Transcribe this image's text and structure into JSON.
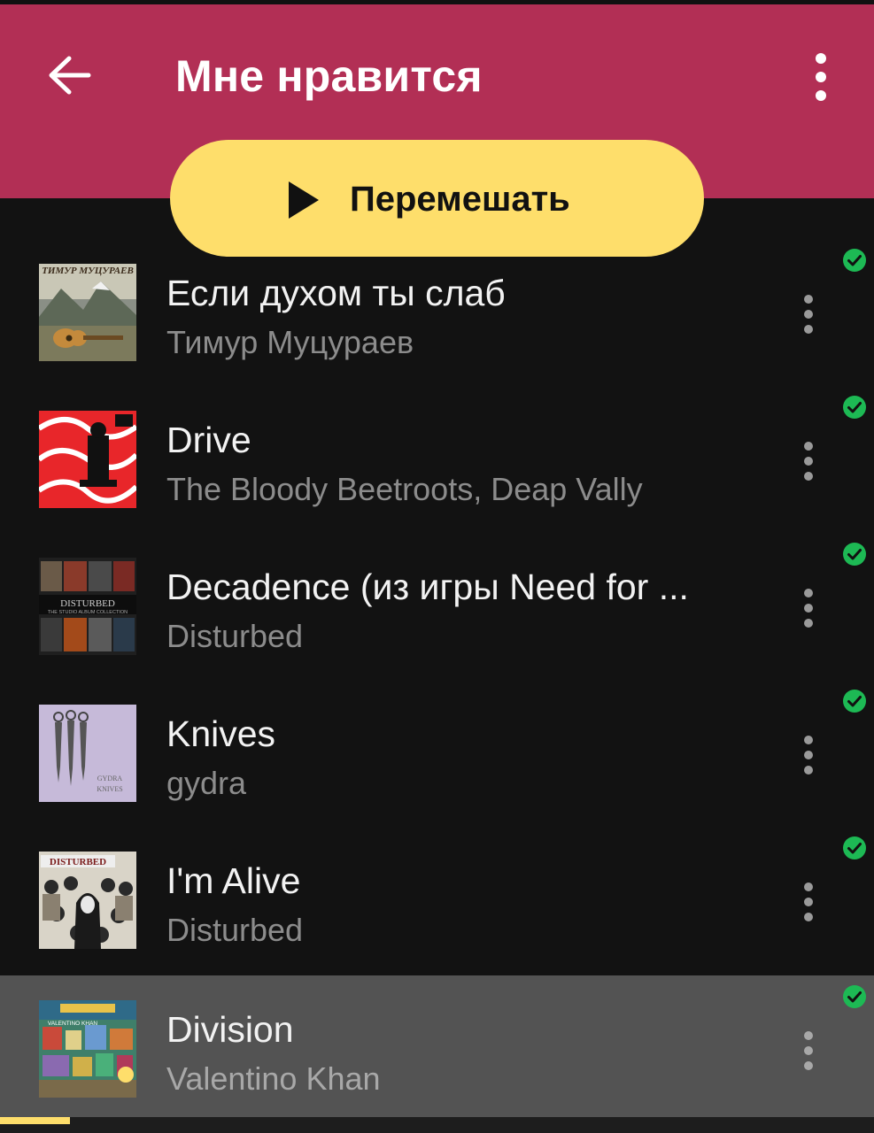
{
  "header": {
    "title": "Мне нравится",
    "back_icon": "arrow-left-icon",
    "menu_icon": "more-vertical-icon",
    "color": "#b22f55"
  },
  "shuffle": {
    "label": "Перемешать",
    "icon": "play-icon",
    "color": "#fede6b"
  },
  "tracks": [
    {
      "title": "Если духом ты слаб",
      "artist": "Тимур Муцураев",
      "cover_text": "ТИМУР МУЦУРАЕВ",
      "downloaded": true
    },
    {
      "title": "Drive",
      "artist": "The Bloody Beetroots, Deap Vally",
      "cover_text": "",
      "downloaded": true
    },
    {
      "title": "Decadence (из игры Need for ...",
      "artist": "Disturbed",
      "cover_text": "DISTURBED",
      "cover_subtext": "THE STUDIO ALBUM COLLECTION",
      "downloaded": true
    },
    {
      "title": "Knives",
      "artist": "gydra",
      "cover_text": "GYDRA",
      "cover_subtext": "KNIVES",
      "downloaded": true
    },
    {
      "title": "I'm Alive",
      "artist": "Disturbed",
      "cover_text": "DISTURBED",
      "downloaded": true
    },
    {
      "title": "Division",
      "artist": "Valentino Khan",
      "cover_text": "VALENTINO KHAN",
      "downloaded": true,
      "now_playing": true
    }
  ],
  "player": {
    "progress": 0.08
  },
  "colors": {
    "check": "#1db954",
    "background": "#121212",
    "active_row": "#535353"
  }
}
